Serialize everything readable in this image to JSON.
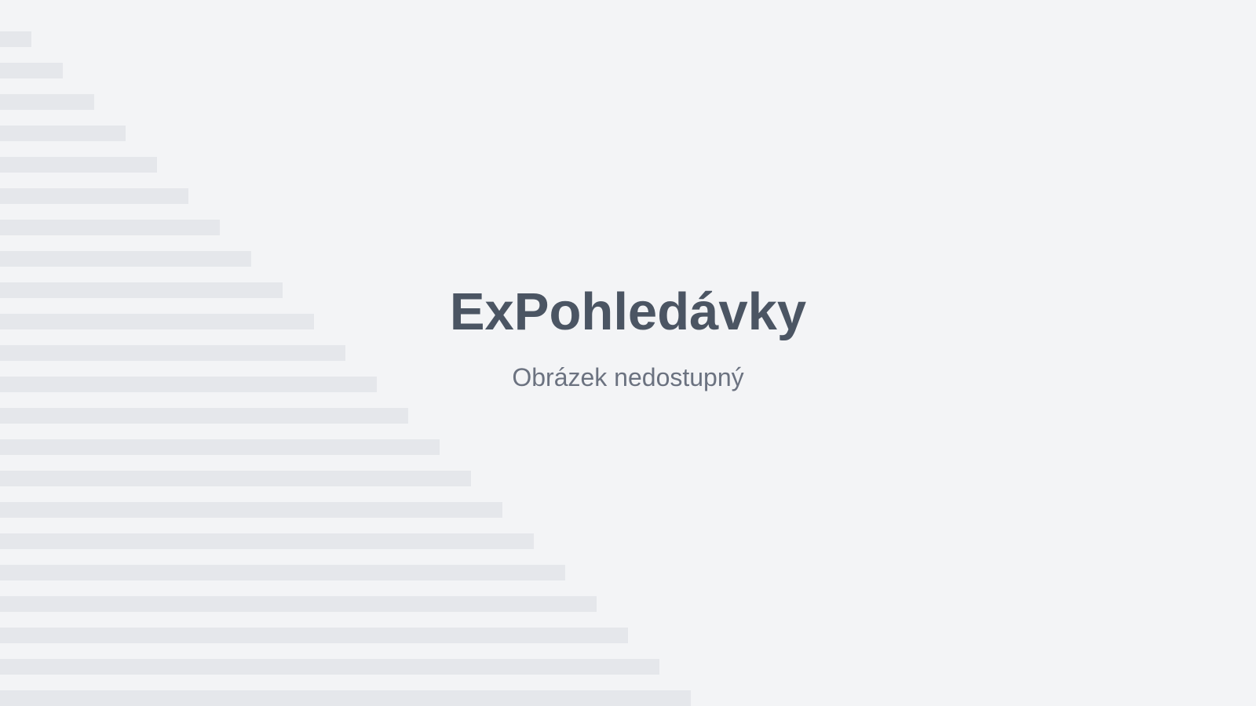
{
  "placeholder": {
    "title": "ExPohledávky",
    "subtitle": "Obrázek nedostupný"
  },
  "colors": {
    "background": "#f3f4f6",
    "stripe": "#e5e7eb",
    "title": "#4b5563",
    "subtitle": "#6b7280"
  }
}
